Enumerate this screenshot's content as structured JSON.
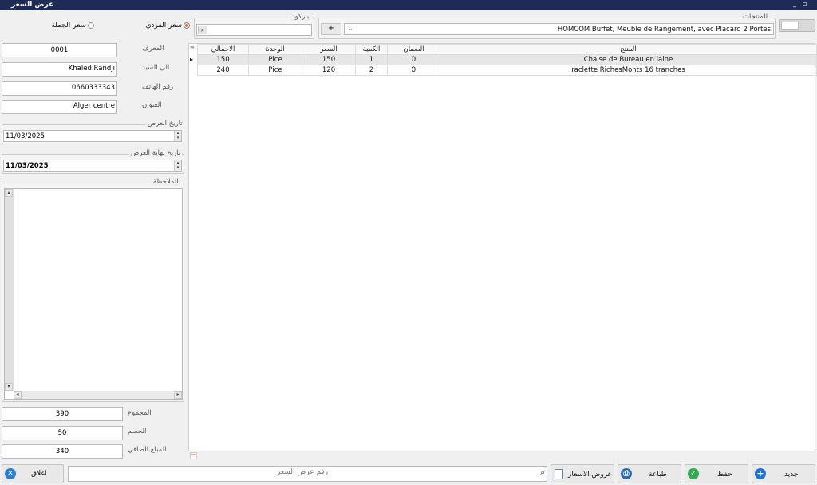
{
  "window": {
    "title": "عرض السعر",
    "minimize": "_",
    "restore": "▫"
  },
  "price_mode": {
    "retail_label": "سعر الفردي",
    "wholesale_label": "سعر الجملة",
    "selected": "retail"
  },
  "barcode": {
    "label": "باركود",
    "value": ""
  },
  "products": {
    "label": "المنتجات",
    "add_label": "+",
    "selected": "HOMCOM Buffet, Meuble de Rangement, avec Placard 2 Portes"
  },
  "form": {
    "id_label": "المعرف",
    "id_value": "0001",
    "customer_label": "الى السيد",
    "customer_value": "Khaled Randji",
    "phone_label": "رقم الهاتف",
    "phone_value": "0660333343",
    "address_label": "العنوان",
    "address_value": "Alger centre",
    "offer_date_label": "تاريخ العرض",
    "offer_date_value": "11/03/2025",
    "end_date_label": "تاريخ نهاية العرض",
    "end_date_value": "11/03/2025",
    "notes_label": "الملاحظة",
    "total_label": "المجموع",
    "total_value": "390",
    "discount_label": "الخصم",
    "discount_value": "50",
    "net_label": "المبلغ الصافي",
    "net_value": "340"
  },
  "grid": {
    "columns": [
      "الاجمالي",
      "الوحدة",
      "السعر",
      "الكمية",
      "الضمان",
      "المنتج"
    ],
    "rows": [
      [
        "150",
        "Pice",
        "150",
        "1",
        "0",
        "Chaise de Bureau en laine"
      ],
      [
        "240",
        "Pice",
        "120",
        "2",
        "0",
        "raclette RichesMonts 16 tranches"
      ]
    ],
    "current_row_marker": "▸",
    "delete_label": "−"
  },
  "footer": {
    "close_label": "اغلاق",
    "search_placeholder": "رقم عرض السعر",
    "quotes_label": "عروض الاسعار",
    "print_label": "طباعة",
    "save_label": "حفظ",
    "new_label": "جديد"
  },
  "colors": {
    "titlebar": "#1f2b57",
    "radio_active": "#e8622a",
    "close_blue": "#2a7fd4",
    "save_green": "#34a853",
    "new_blue": "#1e73d6",
    "print_blue": "#2b6cb0"
  }
}
